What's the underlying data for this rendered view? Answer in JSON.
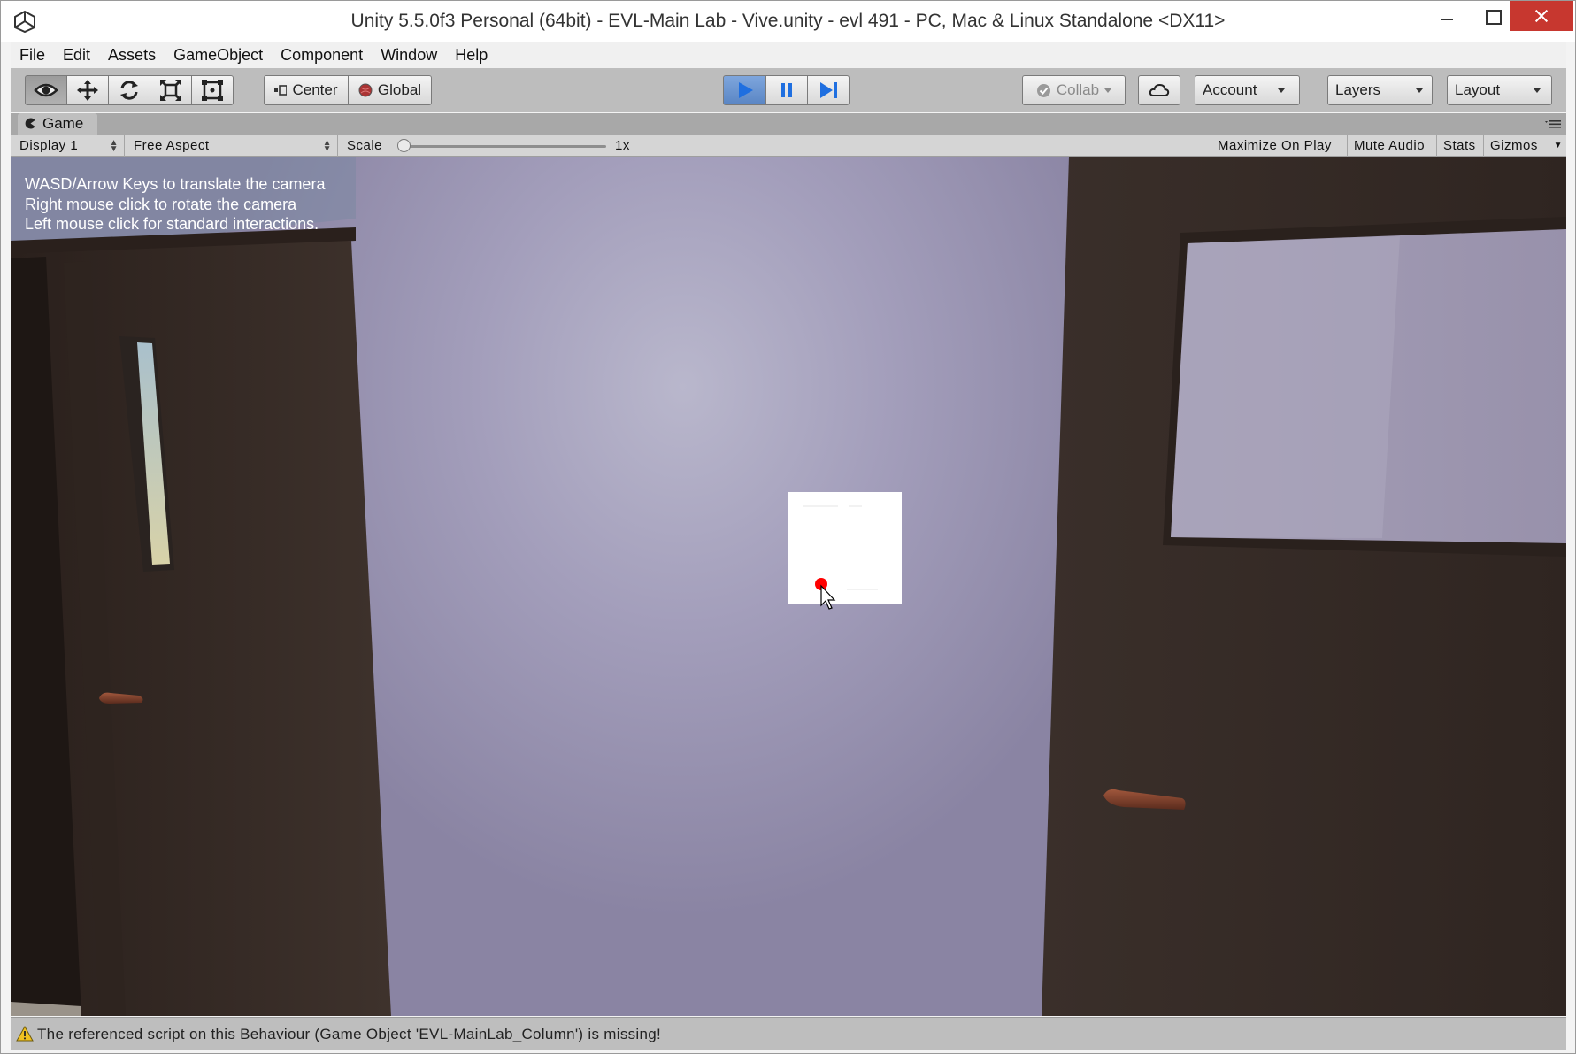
{
  "window": {
    "title": "Unity 5.5.0f3 Personal (64bit) - EVL-Main Lab - Vive.unity - evl 491 - PC, Mac & Linux Standalone <DX11>"
  },
  "menu": {
    "items": [
      "File",
      "Edit",
      "Assets",
      "GameObject",
      "Component",
      "Window",
      "Help"
    ]
  },
  "toolbar": {
    "transform_tools": [
      "view-tool",
      "move-tool",
      "rotate-tool",
      "scale-tool",
      "rect-tool"
    ],
    "active_tool": "view-tool",
    "pivot_label": "Center",
    "space_label": "Global",
    "play_state": "playing",
    "collab_label": "Collab",
    "account_label": "Account",
    "layers_label": "Layers",
    "layout_label": "Layout"
  },
  "game_panel": {
    "tab_label": "Game",
    "display_label": "Display 1",
    "aspect_label": "Free Aspect",
    "scale_label": "Scale",
    "scale_value": "1x",
    "scale_fraction": 0.0,
    "maximize_label": "Maximize On Play",
    "mute_label": "Mute Audio",
    "stats_label": "Stats",
    "gizmos_label": "Gizmos"
  },
  "game_view": {
    "instructions": [
      "WASD/Arrow Keys to translate the camera",
      "Right mouse click to rotate the camera",
      "Left mouse click for standard interactions."
    ]
  },
  "status": {
    "message": "The referenced script on this Behaviour (Game Object 'EVL-MainLab_Column') is missing!",
    "level": "warning"
  },
  "colors": {
    "play_active": "#5a86c4",
    "wall": "#a39ebb",
    "door": "#3d3029",
    "handle": "#7a3e2a",
    "close_button": "#c7372f",
    "warning": "#f0c020"
  }
}
